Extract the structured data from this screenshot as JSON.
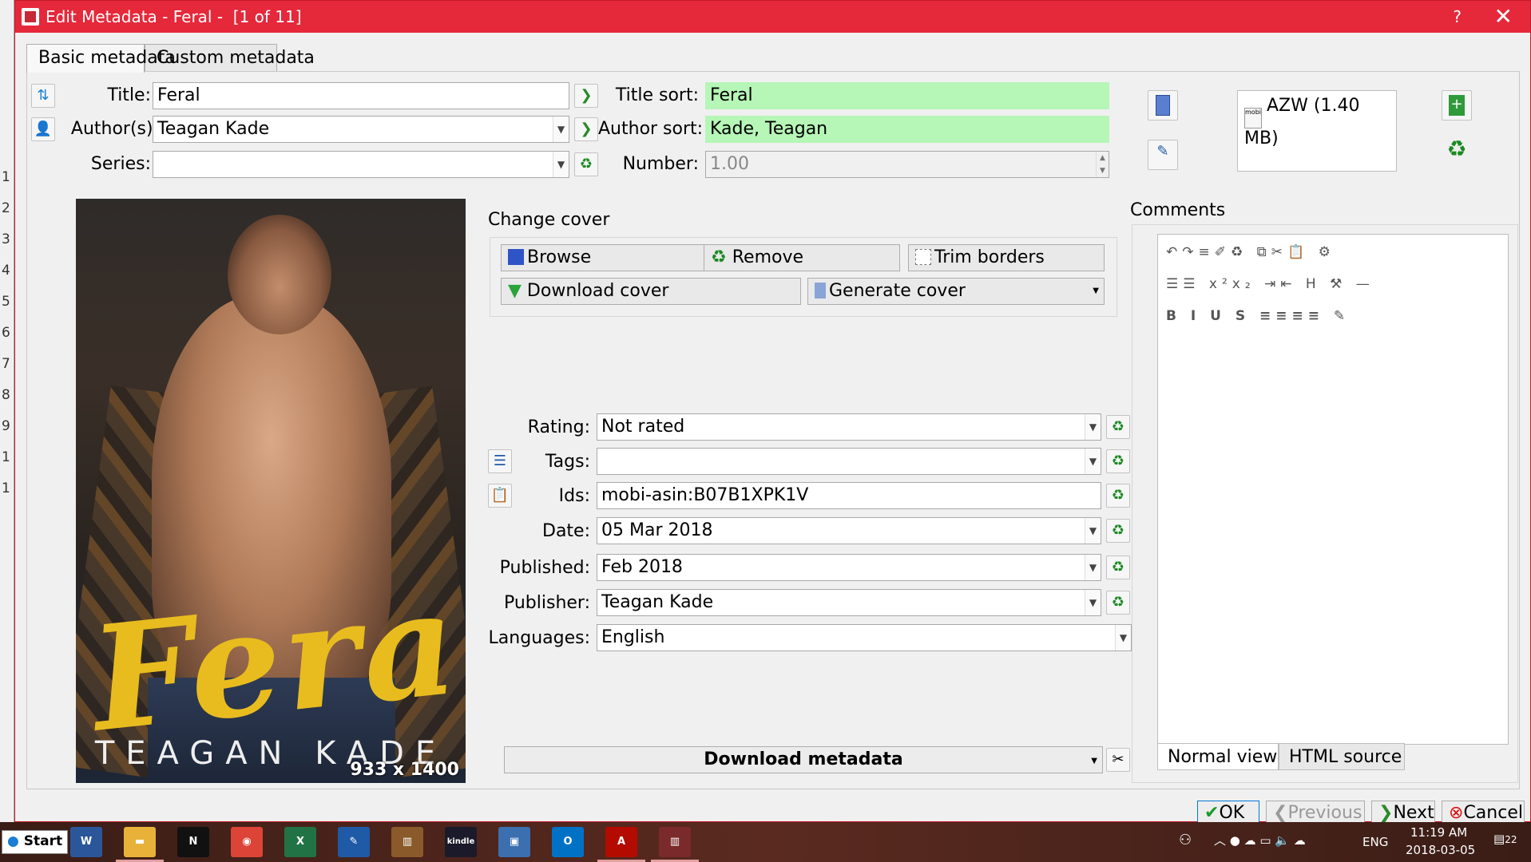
{
  "window": {
    "title": "Edit Metadata - Feral -  [1 of 11]",
    "help": "?",
    "close": "✕"
  },
  "tabs": [
    {
      "label": "Basic metadata",
      "active": true
    },
    {
      "label": "Custom metadata",
      "active": false
    }
  ],
  "fields": {
    "title_label": "Title:",
    "title_value": "Feral",
    "title_sort_label": "Title sort:",
    "title_sort_value": "Feral",
    "authors_label": "Author(s):",
    "authors_value": "Teagan Kade",
    "author_sort_label": "Author sort:",
    "author_sort_value": "Kade, Teagan",
    "series_label": "Series:",
    "series_value": "",
    "number_label": "Number:",
    "number_value": "1.00",
    "rating_label": "Rating:",
    "rating_value": "Not rated",
    "tags_label": "Tags:",
    "tags_value": "",
    "ids_label": "Ids:",
    "ids_value": "mobi-asin:B07B1XPK1V",
    "date_label": "Date:",
    "date_value": "05 Mar 2018",
    "published_label": "Published:",
    "published_value": "Feb 2018",
    "publisher_label": "Publisher:",
    "publisher_value": "Teagan Kade",
    "languages_label": "Languages:",
    "languages_value": "English"
  },
  "cover": {
    "title_text": "Feral",
    "author_text": "TEAGAN KADE",
    "dimensions": "933 x 1400"
  },
  "change_cover": {
    "label": "Change cover",
    "browse": "Browse",
    "remove": "Remove",
    "trim": "Trim borders",
    "download": "Download cover",
    "generate": "Generate cover"
  },
  "formats": {
    "item": "AZW (1.40 MB)",
    "item_icon_label": "mobi"
  },
  "comments": {
    "label": "Comments",
    "normal_view": "Normal view",
    "html_source": "HTML source"
  },
  "download_metadata": "Download metadata",
  "buttons": {
    "ok": "OK",
    "previous": "Previous",
    "next": "Next",
    "cancel": "Cancel"
  },
  "taskbar": {
    "start": "Start",
    "lang": "ENG",
    "time": "11:19 AM",
    "date": "2018-03-05",
    "notifications": "22",
    "apps": [
      {
        "name": "word-app",
        "label": "W",
        "color": "#2b579a"
      },
      {
        "name": "file-explorer-app",
        "label": "▬",
        "color": "#e8b23a"
      },
      {
        "name": "netflix-app",
        "label": "N",
        "color": "#111111"
      },
      {
        "name": "chrome-app",
        "label": "◉",
        "color": "#db4437"
      },
      {
        "name": "excel-app",
        "label": "X",
        "color": "#217346"
      },
      {
        "name": "tool-app",
        "label": "✎",
        "color": "#1f5aa6"
      },
      {
        "name": "library-app",
        "label": "▥",
        "color": "#8a5a2a"
      },
      {
        "name": "kindle-app",
        "label": "kindle",
        "color": "#1a1a2a"
      },
      {
        "name": "network-app",
        "label": "▣",
        "color": "#3b6fb0"
      },
      {
        "name": "outlook-app",
        "label": "O",
        "color": "#0072c6"
      },
      {
        "name": "pdf-app",
        "label": "A",
        "color": "#b30b00"
      },
      {
        "name": "calibre-app",
        "label": "▥",
        "color": "#7a2a2a"
      }
    ]
  },
  "left_strip_numbers": [
    "1",
    "2",
    "3",
    "4",
    "5",
    "6",
    "7",
    "8",
    "9",
    "1",
    "1"
  ]
}
